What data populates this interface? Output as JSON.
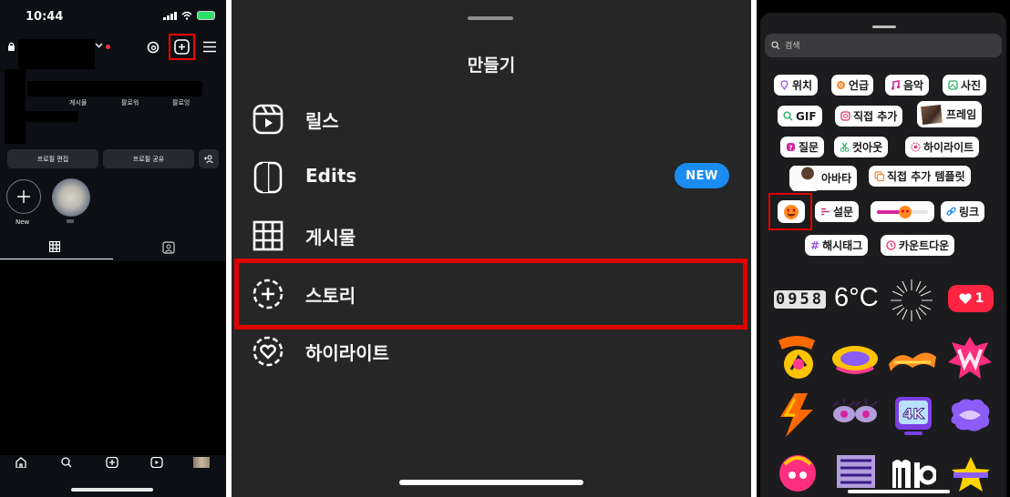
{
  "profile": {
    "status_time": "10:44",
    "stats": [
      "게시물",
      "팔로워",
      "팔로잉"
    ],
    "buttons": [
      "프로필 편집",
      "프로필 공유"
    ],
    "new_highlight_label": "New"
  },
  "create_menu": {
    "title": "만들기",
    "items": [
      {
        "label": "릴스",
        "icon": "reels-icon"
      },
      {
        "label": "Edits",
        "icon": "edits-icon",
        "badge": "NEW"
      },
      {
        "label": "게시물",
        "icon": "grid-post-icon"
      },
      {
        "label": "스토리",
        "icon": "story-add-icon"
      },
      {
        "label": "하이라이트",
        "icon": "highlight-heart-icon"
      }
    ],
    "badge_color": "#1b8cf2",
    "highlight_box_color": "#e00000"
  },
  "stickers": {
    "search_placeholder": "검색",
    "rows": [
      [
        "위치",
        "언급",
        "음악",
        "사진"
      ],
      [
        "GIF",
        "직접 추가",
        "프레임"
      ],
      [
        "질문",
        "컷아웃",
        "하이라이트"
      ],
      [
        "아바타",
        "직접 추가 템플릿"
      ],
      [
        "설문",
        "링크"
      ],
      [
        "해시태그",
        "카운트다운"
      ]
    ],
    "clock_digits": "0958",
    "temperature": "6°C",
    "like_count": "1"
  }
}
